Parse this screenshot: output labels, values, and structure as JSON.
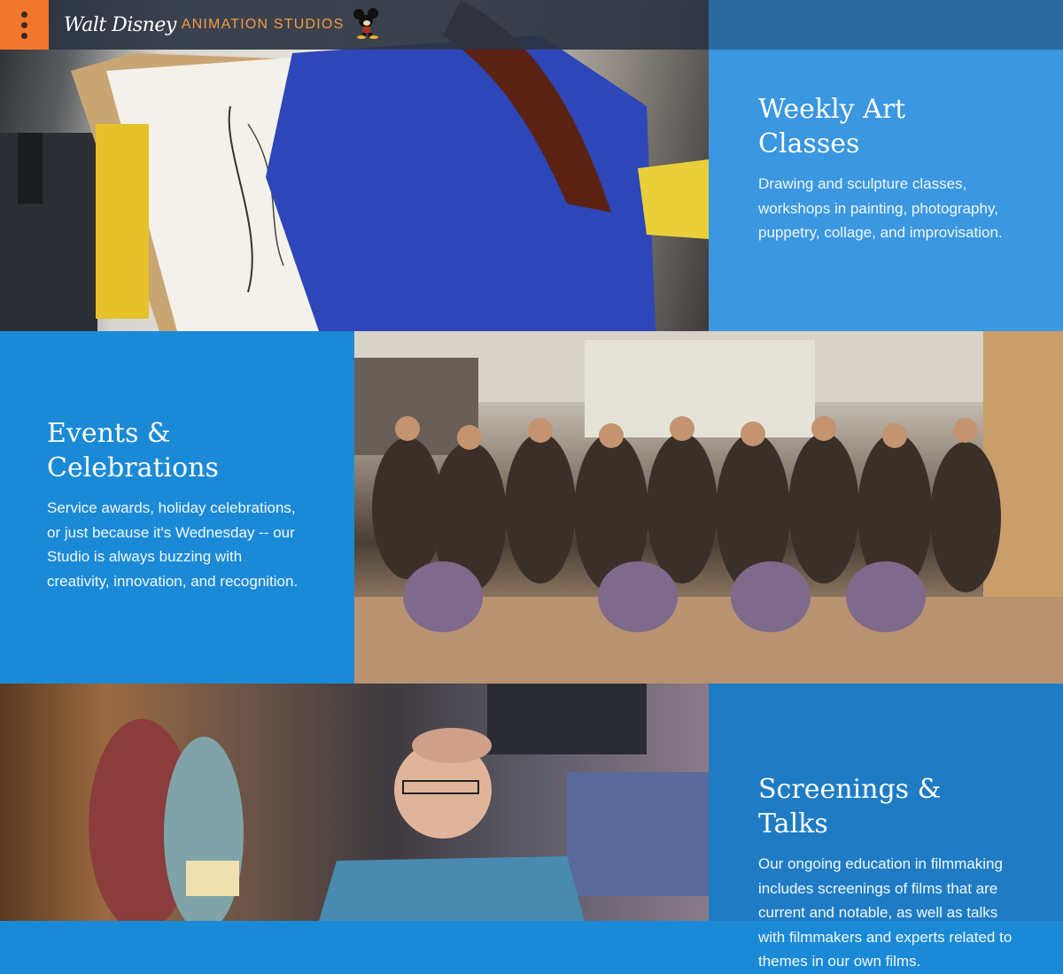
{
  "header": {
    "logo_script": "Walt Disney",
    "logo_text": "ANIMATION STUDIOS",
    "menu_icon": "kebab-menu-icon",
    "accent_color": "#f2772d"
  },
  "sections": [
    {
      "title": "Weekly Art Classes",
      "body": "Drawing and sculpture classes, workshops in painting, photography, puppetry, collage, and improvisation.",
      "photo": "artist-drawing-photo"
    },
    {
      "title": "Events & Celebrations",
      "body": "Service awards, holiday celebrations, or just because it's Wednesday -- our Studio is always buzzing with creativity, innovation, and recognition.",
      "photo": "group-photo"
    },
    {
      "title": "Screenings & Talks",
      "body": "Our ongoing education in filmmaking includes screenings of films that are current and notable, as well as talks with filmmakers and experts related to themes in our own films.",
      "photo": "speaker-talk-photo"
    }
  ],
  "colors": {
    "panel_blue": "#3a97e0",
    "panel_blue_dark": "#1b8ad6",
    "header_bg": "#2c3442"
  }
}
